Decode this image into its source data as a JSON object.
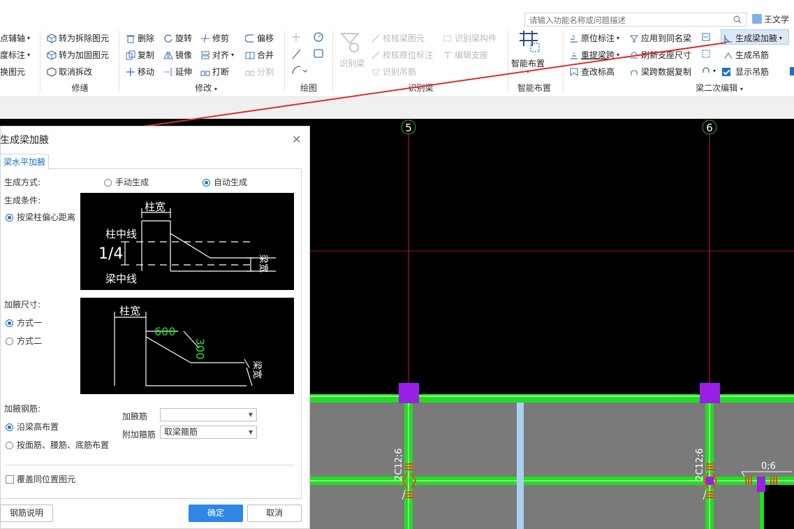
{
  "search": {
    "placeholder": "请输入功能名称或问题描述"
  },
  "user": {
    "name": "王文学"
  },
  "ribbon": {
    "left_items": [
      "点辅轴",
      "度标注",
      "换图元"
    ],
    "group1": {
      "items": [
        "转为拆除图元",
        "转为加固图元",
        "取消拆改"
      ],
      "label": "修缮"
    },
    "group2": {
      "items": [
        "删除",
        "旋转",
        "修剪",
        "偏移",
        "复制",
        "镜像",
        "对齐",
        "合并",
        "移动",
        "延伸",
        "打断",
        "分割"
      ],
      "label": "修改"
    },
    "group3": {
      "label": "绘图"
    },
    "group4": {
      "big": "识别梁",
      "items": [
        "校核梁图元",
        "识别梁构件",
        "校核原位标注",
        "编辑支座",
        "识别吊筋"
      ],
      "label": "识别梁"
    },
    "group5": {
      "big": "智能布置",
      "label": "智能布置"
    },
    "group6": {
      "items": [
        "原位标注",
        "应用到同名梁",
        "生成梁加腋",
        "重提梁跨",
        "刷新支座尺寸",
        "生成吊筋",
        "查改标高",
        "梁跨数据复制",
        "显示吊筋"
      ],
      "label": "梁二次编辑"
    }
  },
  "canvas": {
    "axis_labels": [
      "5",
      "6"
    ],
    "rebar_labels": [
      "2C12;6",
      "2C12;6",
      "0;6"
    ]
  },
  "colors": {
    "accent": "#2e86e6",
    "beam_green": "#22dd22",
    "column_purple": "#9b1ee6",
    "axis_red": "#c81e1e",
    "arrow": "#e02b2b"
  },
  "dialog": {
    "title": "生成梁加腋",
    "tab": "梁水平加腋",
    "gen_mode_label": "生成方式:",
    "gen_mode_options": [
      "手动生成",
      "自动生成"
    ],
    "gen_mode_selected": "自动生成",
    "condition_label": "生成条件:",
    "condition_option": "按梁柱偏心距离",
    "diagram1": {
      "col_width": "柱宽",
      "col_center": "柱中线",
      "ratio": "1/4",
      "beam_center": "梁中线",
      "beam_width": "梁宽"
    },
    "size_label": "加腋尺寸:",
    "size_options": [
      "方式一",
      "方式二"
    ],
    "diagram2": {
      "col_width": "柱宽",
      "len": "600",
      "width": "300",
      "beam_width": "梁宽"
    },
    "rebar_label": "加腋钢筋:",
    "rebar_options": [
      "沿梁高布置",
      "按面筋、腰筋、底筋布置"
    ],
    "haunch_bar_label": "加腋筋",
    "haunch_bar_value": "",
    "stirrup_label": "附加箍筋",
    "stirrup_value": "取梁箍筋",
    "overwrite_label": "覆盖同位置图元",
    "buttons": {
      "help": "钢筋说明",
      "ok": "确定",
      "cancel": "取消"
    }
  }
}
